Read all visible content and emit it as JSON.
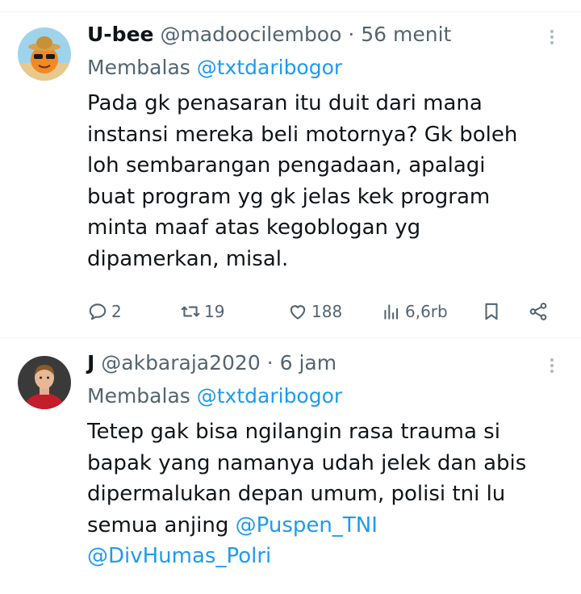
{
  "tweets": [
    {
      "name": "U-bee",
      "handle": "@madoocilemboo",
      "sep": "·",
      "time": "56 menit",
      "reply_prefix": "Membalas",
      "reply_handle": "@txtdaribogor",
      "text_lines": [
        "Pada gk penasaran itu duit dari mana",
        "instansi mereka beli motornya? Gk boleh",
        "loh sembarangan pengadaan, apalagi",
        "buat program yg gk jelas kek program",
        "minta maaf atas kegoblogan yg",
        "dipamerkan, misal."
      ],
      "replies": "2",
      "retweets": "19",
      "likes": "188",
      "views": "6,6rb"
    },
    {
      "name": "J",
      "handle": "@akbaraja2020",
      "sep": "·",
      "time": "6 jam",
      "reply_prefix": "Membalas",
      "reply_handle": "@txtdaribogor",
      "text_lines": [
        "Tetep gak bisa ngilangin rasa trauma si",
        "bapak yang namanya udah jelek dan abis",
        "dipermalukan depan umum, polisi tni lu",
        "semua anjing "
      ],
      "mentions": [
        "@Puspen_TNI",
        "@DivHumas_Polri"
      ]
    }
  ],
  "colors": {
    "text": "#0f1419",
    "secondary": "#536471",
    "link": "#1d9bf0",
    "divider": "#eff3f4"
  },
  "icons": [
    "reply-icon",
    "retweet-icon",
    "like-icon",
    "views-icon",
    "bookmark-icon",
    "share-icon",
    "more-icon"
  ]
}
